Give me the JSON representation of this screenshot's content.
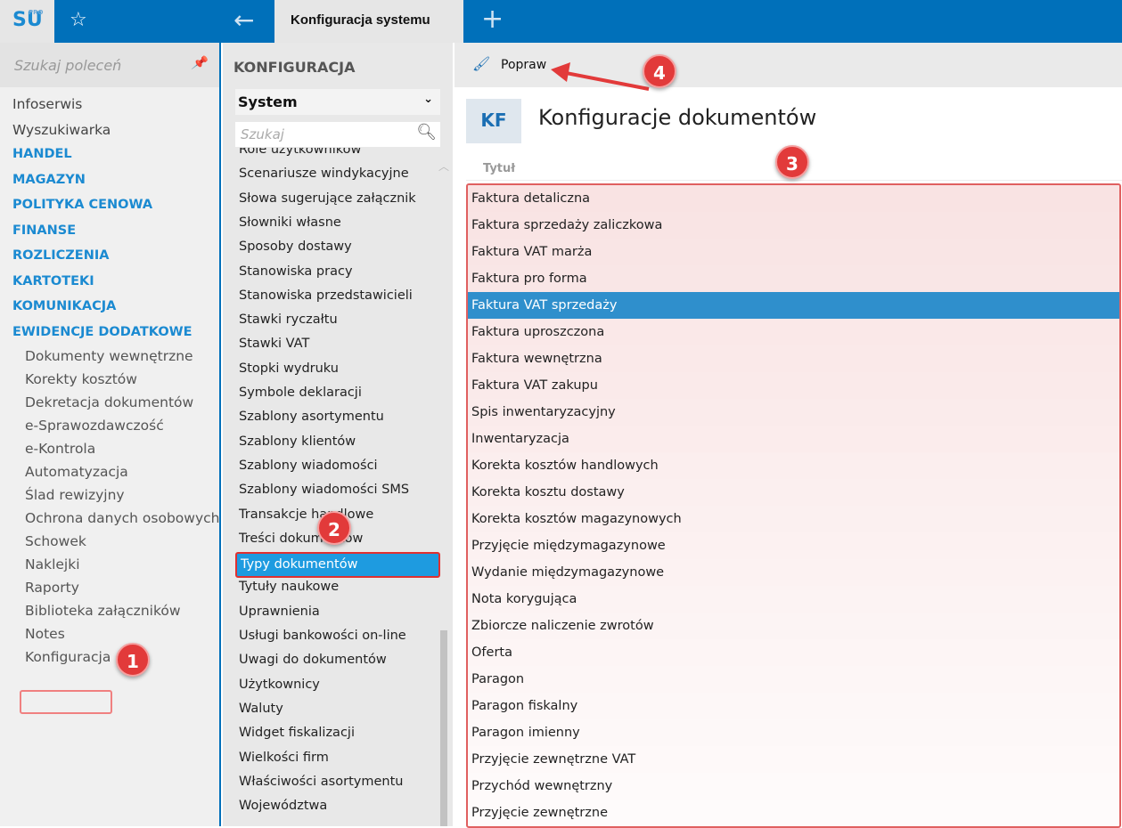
{
  "topbar": {
    "logo": "SU",
    "logo_sup": "PRO",
    "tab_title": "Konfiguracja systemu"
  },
  "left": {
    "search_placeholder": "Szukaj poleceń",
    "items": [
      {
        "label": "Infoserwis",
        "type": "item"
      },
      {
        "label": "Wyszukiwarka",
        "type": "item"
      },
      {
        "label": "HANDEL",
        "type": "cat"
      },
      {
        "label": "MAGAZYN",
        "type": "cat"
      },
      {
        "label": "POLITYKA CENOWA",
        "type": "cat"
      },
      {
        "label": "FINANSE",
        "type": "cat"
      },
      {
        "label": "ROZLICZENIA",
        "type": "cat"
      },
      {
        "label": "KARTOTEKI",
        "type": "cat"
      },
      {
        "label": "KOMUNIKACJA",
        "type": "cat"
      },
      {
        "label": "EWIDENCJE DODATKOWE",
        "type": "cat"
      },
      {
        "label": "Dokumenty wewnętrzne",
        "type": "sub"
      },
      {
        "label": "Korekty kosztów",
        "type": "sub"
      },
      {
        "label": "Dekretacja dokumentów",
        "type": "sub"
      },
      {
        "label": "e-Sprawozdawczość",
        "type": "sub"
      },
      {
        "label": "e-Kontrola",
        "type": "sub"
      },
      {
        "label": "Automatyzacja",
        "type": "sub"
      },
      {
        "label": "Ślad rewizyjny",
        "type": "sub"
      },
      {
        "label": "Ochrona danych osobowych",
        "type": "sub"
      },
      {
        "label": "Schowek",
        "type": "sub"
      },
      {
        "label": "Naklejki",
        "type": "sub"
      },
      {
        "label": "Raporty",
        "type": "sub"
      },
      {
        "label": "Biblioteka załączników",
        "type": "sub"
      },
      {
        "label": "Notes",
        "type": "sub"
      },
      {
        "label": "Konfiguracja",
        "type": "sub"
      }
    ]
  },
  "middle": {
    "title": "KONFIGURACJA",
    "select_value": "System",
    "search_placeholder": "Szukaj",
    "items": [
      "Role użytkowników",
      "Scenariusze windykacyjne",
      "Słowa sugerujące załącznik",
      "Słowniki własne",
      "Sposoby dostawy",
      "Stanowiska pracy",
      "Stanowiska przedstawicieli",
      "Stawki ryczałtu",
      "Stawki VAT",
      "Stopki wydruku",
      "Symbole deklaracji",
      "Szablony asortymentu",
      "Szablony klientów",
      "Szablony wiadomości",
      "Szablony wiadomości SMS",
      "Transakcje handlowe",
      "Treści dokumentów",
      "Typy dokumentów",
      "Tytuły naukowe",
      "Uprawnienia",
      "Usługi bankowości on-line",
      "Uwagi do dokumentów",
      "Użytkownicy",
      "Waluty",
      "Widget fiskalizacji",
      "Wielkości firm",
      "Właściwości asortymentu",
      "Województwa"
    ],
    "selected_index": 17
  },
  "main": {
    "toolbar_button": "Popraw",
    "badge": "KF",
    "title": "Konfiguracje dokumentów",
    "column_header": "Tytuł",
    "rows": [
      "Faktura detaliczna",
      "Faktura sprzedaży zaliczkowa",
      "Faktura VAT marża",
      "Faktura pro forma",
      "Faktura VAT sprzedaży",
      "Faktura uproszczona",
      "Faktura wewnętrzna",
      "Faktura VAT zakupu",
      "Spis inwentaryzacyjny",
      "Inwentaryzacja",
      "Korekta kosztów handlowych",
      "Korekta kosztu dostawy",
      "Korekta kosztów magazynowych",
      "Przyjęcie międzymagazynowe",
      "Wydanie międzymagazynowe",
      "Nota korygująca",
      "Zbiorcze naliczenie zwrotów",
      "Oferta",
      "Paragon",
      "Paragon fiskalny",
      "Paragon imienny",
      "Przyjęcie zewnętrzne VAT",
      "Przychód wewnętrzny",
      "Przyjęcie zewnętrzne"
    ],
    "selected_index": 4
  },
  "annotations": [
    "1",
    "2",
    "3",
    "4"
  ]
}
